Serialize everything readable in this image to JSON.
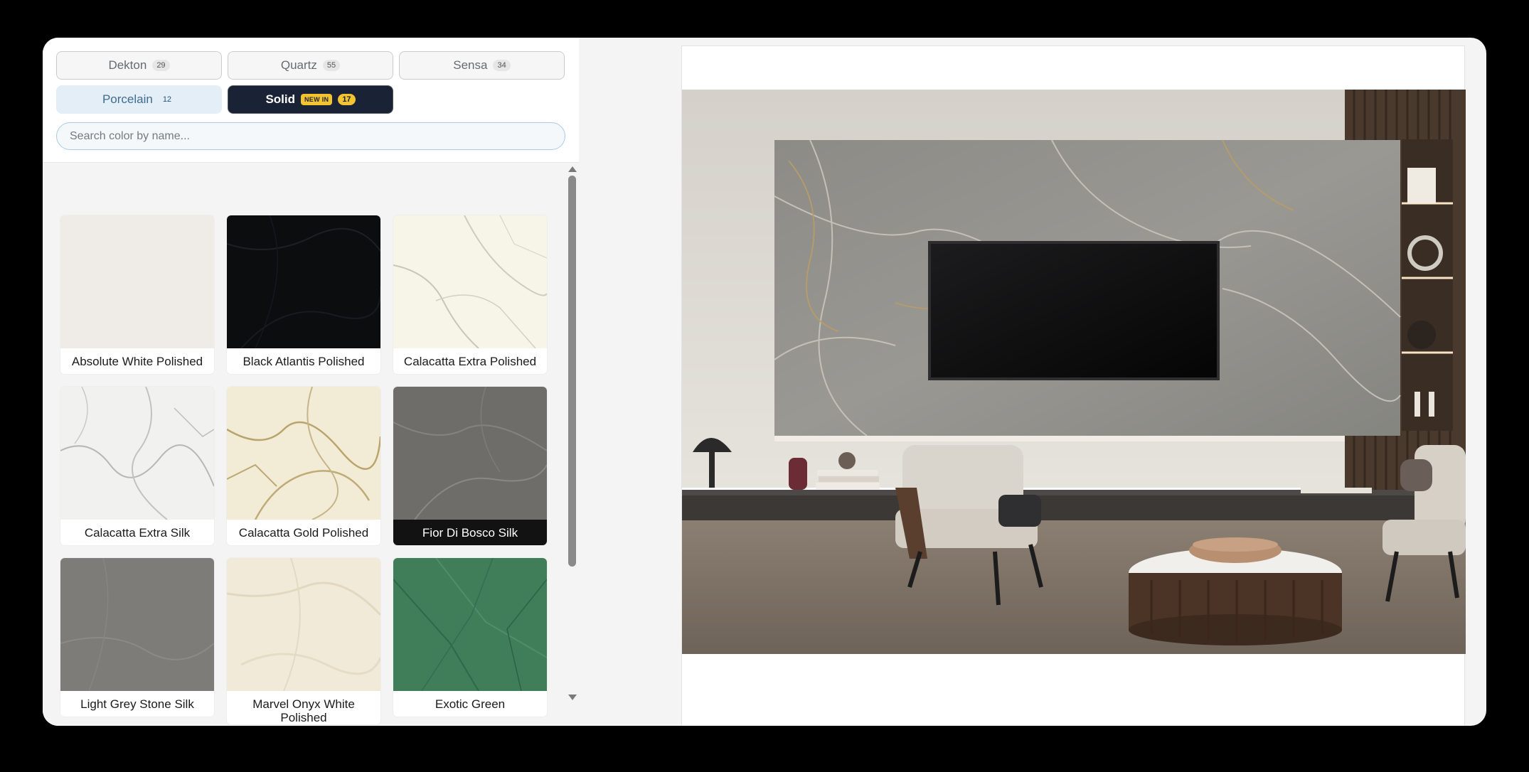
{
  "filters": {
    "tabs": [
      {
        "label": "Dekton",
        "count": "29"
      },
      {
        "label": "Quartz",
        "count": "55"
      },
      {
        "label": "Sensa",
        "count": "34"
      },
      {
        "label": "Porcelain",
        "count": "12"
      },
      {
        "label": "Solid",
        "badge": "NEW IN",
        "count": "17"
      }
    ],
    "active_tab": "Solid"
  },
  "search": {
    "placeholder": "Search color by name...",
    "value": ""
  },
  "colors": [
    {
      "name": "Absolute White Polished",
      "tone": "#efebe6"
    },
    {
      "name": "Black Atlantis Polished",
      "tone": "#0c0d0f"
    },
    {
      "name": "Calacatta Extra Polished",
      "tone": "#f7f5e8"
    },
    {
      "name": "Calacatta Extra Silk",
      "tone": "#f1f1ef"
    },
    {
      "name": "Calacatta Gold Polished",
      "tone": "#f2ecd6"
    },
    {
      "name": "Fior Di Bosco Silk",
      "tone": "#6f6d69",
      "selected": true
    },
    {
      "name": "Light Grey Stone Silk",
      "tone": "#7d7c78"
    },
    {
      "name": "Marvel Onyx White Polished",
      "tone": "#f1ead9"
    },
    {
      "name": "Exotic Green",
      "tone": "#3f7e59"
    }
  ],
  "accent": {
    "solid_tab": "#1a2236",
    "badge": "#f3c430",
    "porcelain_tab": "#e4eef6"
  }
}
